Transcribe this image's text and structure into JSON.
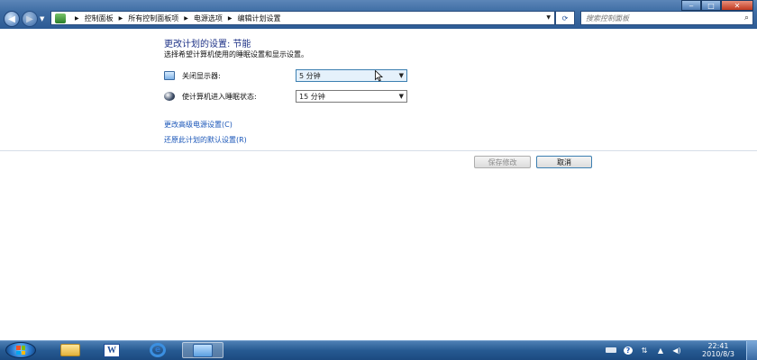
{
  "window": {
    "controls": {
      "minimize": "‒",
      "maximize": "□",
      "close": "✕"
    }
  },
  "address": {
    "breadcrumbs": [
      "控制面板",
      "所有控制面板项",
      "电源选项",
      "编辑计划设置"
    ],
    "search_placeholder": "搜索控制面板"
  },
  "page": {
    "title": "更改计划的设置: 节能",
    "subtitle": "选择希望计算机使用的睡眠设置和显示设置。",
    "settings": [
      {
        "label": "关闭显示器:",
        "value": "5 分钟",
        "icon": "monitor-icon"
      },
      {
        "label": "使计算机进入睡眠状态:",
        "value": "15 分钟",
        "icon": "moon-icon"
      }
    ],
    "links": {
      "advanced": "更改高级电源设置(C)",
      "restore": "还原此计划的默认设置(R)"
    },
    "buttons": {
      "save": "保存修改",
      "cancel": "取消"
    }
  },
  "taskbar": {
    "apps": [
      "windows-explorer",
      "microsoft-word",
      "internet-explorer",
      "control-panel"
    ],
    "clock": {
      "time": "22:41",
      "date": "2010/8/3"
    }
  },
  "colors": {
    "title": "#1e3287",
    "link": "#1a56b8",
    "taskbar": "#265a92"
  }
}
